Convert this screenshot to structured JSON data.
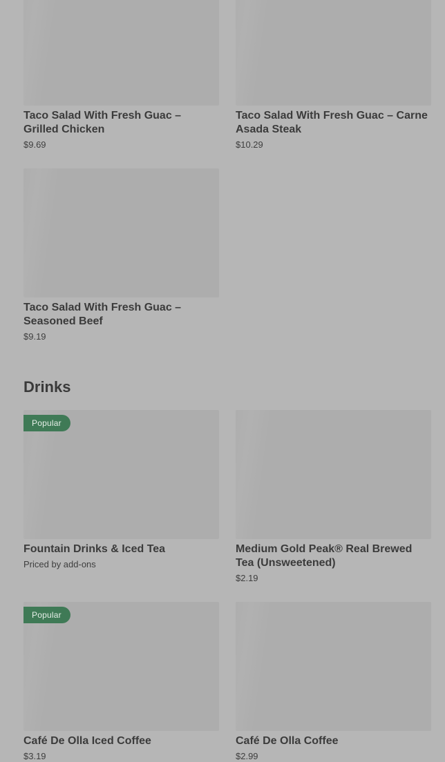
{
  "items_top": [
    {
      "name": "Taco Salad With Fresh Guac – Grilled Chicken",
      "price": "$9.69"
    },
    {
      "name": "Taco Salad With Fresh Guac – Carne Asada Steak",
      "price": "$10.29"
    },
    {
      "name": "Taco Salad With Fresh Guac – Seasoned Beef",
      "price": "$9.19"
    }
  ],
  "drinks_section": {
    "heading": "Drinks",
    "items": [
      {
        "name": "Fountain Drinks & Iced Tea",
        "price": "Priced by add-ons",
        "badge": "Popular"
      },
      {
        "name": "Medium Gold Peak® Real Brewed Tea (Unsweetened)",
        "price": "$2.19"
      },
      {
        "name": "Café De Olla Iced Coffee",
        "price": "$3.19",
        "badge": "Popular"
      },
      {
        "name": "Café De Olla Coffee",
        "price": "$2.99"
      }
    ]
  }
}
